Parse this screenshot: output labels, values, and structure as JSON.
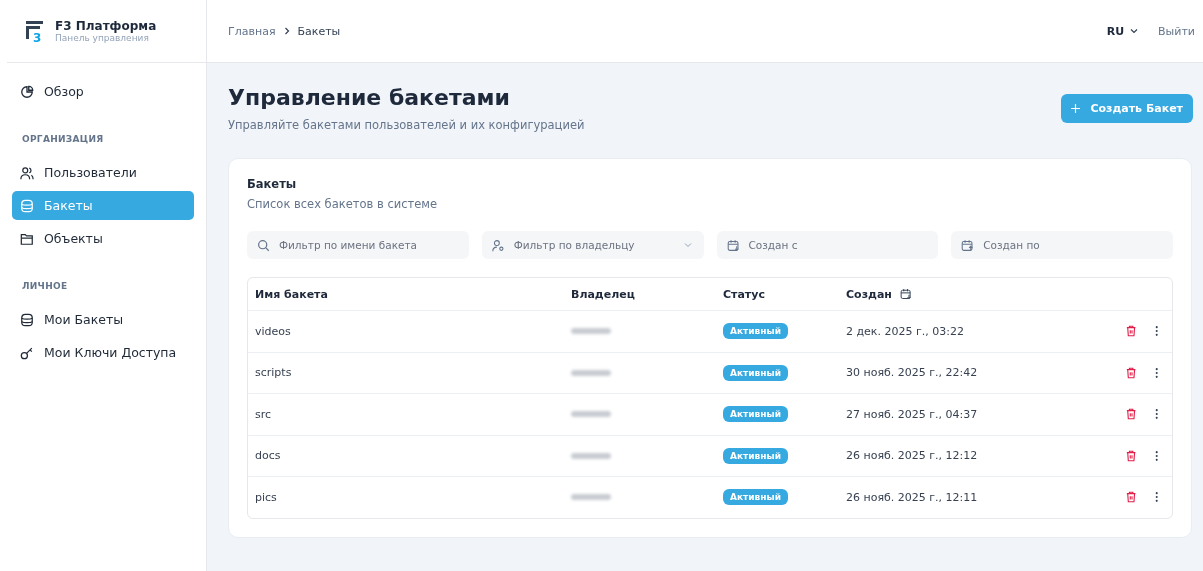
{
  "brand": {
    "logo_text": "3",
    "title": "F3 Платформа",
    "subtitle": "Панель управления"
  },
  "sidebar": {
    "groups": [
      {
        "items": [
          {
            "label": "Обзор",
            "kind": "overview",
            "selected": false
          }
        ]
      },
      {
        "heading": "ОРГАНИЗАЦИЯ",
        "items": [
          {
            "label": "Пользователи",
            "kind": "users",
            "selected": false
          },
          {
            "label": "Бакеты",
            "kind": "buckets",
            "selected": true
          },
          {
            "label": "Объекты",
            "kind": "objects",
            "selected": false
          }
        ]
      },
      {
        "heading": "ЛИЧНОЕ",
        "items": [
          {
            "label": "Мои Бакеты",
            "kind": "buckets",
            "selected": false
          },
          {
            "label": "Мои Ключи Доступа",
            "kind": "keys",
            "selected": false
          }
        ]
      }
    ]
  },
  "breadcrumb": [
    "Главная",
    "Бакеты"
  ],
  "header": {
    "language": "RU",
    "logout": "Выйти"
  },
  "page": {
    "title": "Управление бакетами",
    "subtitle": "Управляйте бакетами пользователей и их конфигурацией",
    "create_button": "Создать Бакет"
  },
  "card": {
    "title": "Бакеты",
    "subtitle": "Список всех бакетов в системе"
  },
  "filters": [
    {
      "kind": "search",
      "placeholder": "Фильтр по имени бакета"
    },
    {
      "kind": "owner",
      "placeholder": "Фильтр по владельцу"
    },
    {
      "kind": "date-from",
      "placeholder": "Создан с"
    },
    {
      "kind": "date-to",
      "placeholder": "Создан по"
    }
  ],
  "table": {
    "columns": [
      "Имя бакета",
      "Владелец",
      "Статус",
      "Создан"
    ],
    "rows": [
      {
        "name": "videos",
        "status": "Активный",
        "created": "2 дек. 2025 г., 03:22"
      },
      {
        "name": "scripts",
        "status": "Активный",
        "created": "30 нояб. 2025 г., 22:42"
      },
      {
        "name": "src",
        "status": "Активный",
        "created": "27 нояб. 2025 г., 04:37"
      },
      {
        "name": "docs",
        "status": "Активный",
        "created": "26 нояб. 2025 г., 12:12"
      },
      {
        "name": "pics",
        "status": "Активный",
        "created": "26 нояб. 2025 г., 12:11"
      }
    ]
  }
}
